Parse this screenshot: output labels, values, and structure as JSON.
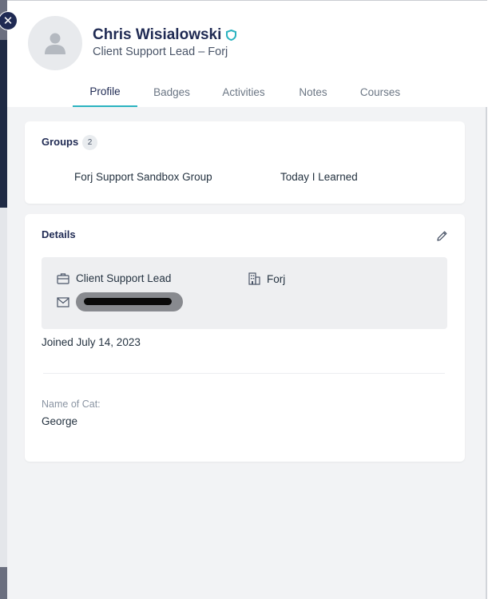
{
  "profile": {
    "name": "Chris Wisialowski",
    "subtitle": "Client Support Lead – Forj"
  },
  "tabs": [
    {
      "label": "Profile",
      "active": true
    },
    {
      "label": "Badges"
    },
    {
      "label": "Activities"
    },
    {
      "label": "Notes"
    },
    {
      "label": "Courses"
    }
  ],
  "groups": {
    "title": "Groups",
    "count": "2",
    "items": [
      "Forj Support Sandbox Group",
      "Today I Learned"
    ]
  },
  "details": {
    "title": "Details",
    "job_title": "Client Support Lead",
    "company": "Forj",
    "joined": "Joined July 14, 2023",
    "custom_field_label": "Name of Cat:",
    "custom_field_value": "George"
  },
  "colors": {
    "accent": "#2bb3c0",
    "navy": "#1f2a53"
  },
  "icons": [
    "close-icon",
    "avatar-placeholder-icon",
    "verified-shield-icon",
    "edit-pencil-icon",
    "briefcase-icon",
    "building-icon",
    "envelope-icon"
  ]
}
